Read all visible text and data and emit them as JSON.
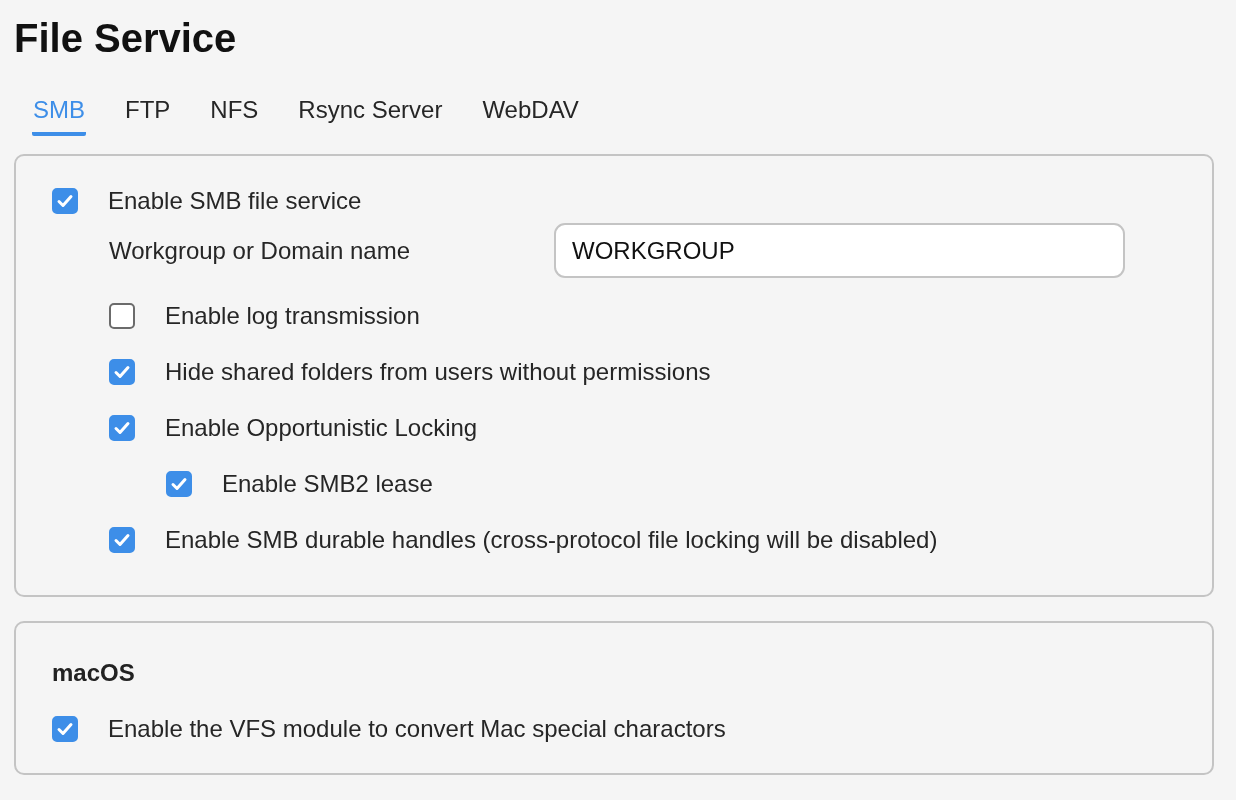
{
  "title": "File Service",
  "tabs": [
    {
      "label": "SMB",
      "selected": true
    },
    {
      "label": "FTP",
      "selected": false
    },
    {
      "label": "NFS",
      "selected": false
    },
    {
      "label": "Rsync Server",
      "selected": false
    },
    {
      "label": "WebDAV",
      "selected": false
    }
  ],
  "smb": {
    "enable": {
      "label": "Enable SMB file service",
      "checked": true
    },
    "workgroup": {
      "label": "Workgroup or Domain name",
      "value": "WORKGROUP"
    },
    "options": [
      {
        "label": "Enable log transmission",
        "checked": false
      },
      {
        "label": "Hide shared folders from users without permissions",
        "checked": true
      },
      {
        "label": "Enable Opportunistic Locking",
        "checked": true,
        "children": [
          {
            "label": "Enable SMB2 lease",
            "checked": true
          }
        ]
      },
      {
        "label": "Enable SMB durable handles (cross-protocol file locking will be disabled)",
        "checked": true
      }
    ]
  },
  "macos": {
    "heading": "macOS",
    "options": [
      {
        "label": "Enable the VFS module to convert Mac special charactors",
        "checked": true
      }
    ]
  }
}
